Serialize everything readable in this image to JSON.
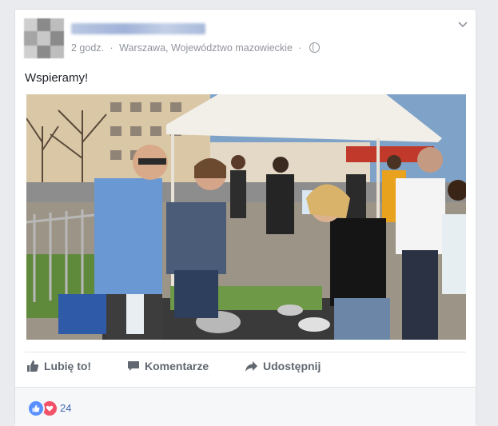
{
  "post": {
    "time": "2 godz.",
    "separator": "·",
    "location": "Warszawa, Województwo mazowieckie",
    "privacy_icon": "globe-icon",
    "text": "Wspieramy!"
  },
  "actions": {
    "like": "Lubię to!",
    "comment": "Komentarze",
    "share": "Udostępnij"
  },
  "reactions": {
    "types": [
      "like",
      "love"
    ],
    "count": "24"
  },
  "colors": {
    "link": "#4267b2",
    "meta": "#90949c",
    "action": "#606770"
  }
}
